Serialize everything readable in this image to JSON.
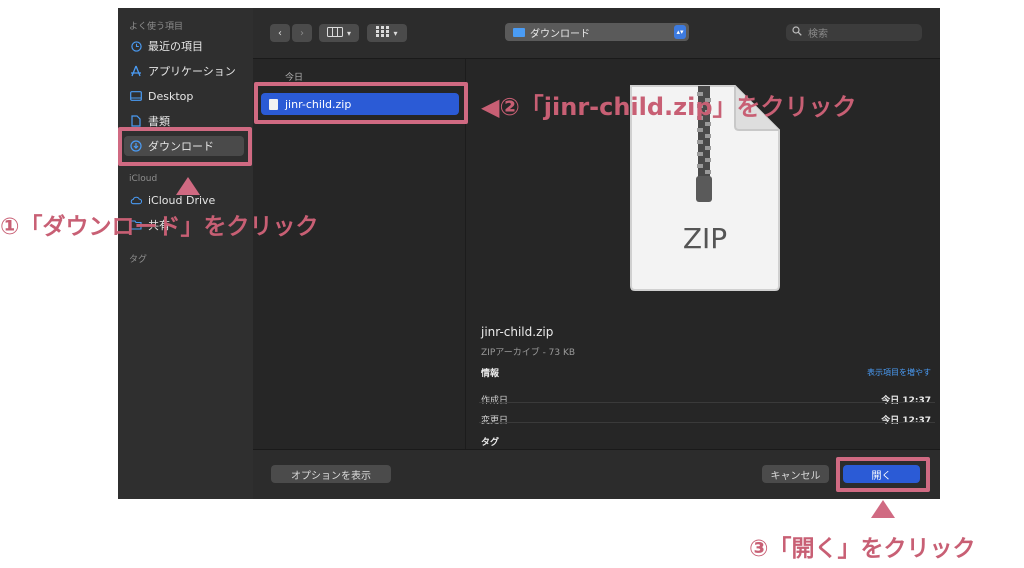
{
  "sidebar": {
    "favorites_header": "よく使う項目",
    "items": [
      {
        "label": "最近の項目",
        "icon": "clock-icon"
      },
      {
        "label": "アプリケーション",
        "icon": "applications-icon"
      },
      {
        "label": "Desktop",
        "icon": "desktop-icon"
      },
      {
        "label": "書類",
        "icon": "document-icon"
      },
      {
        "label": "ダウンロード",
        "icon": "download-icon",
        "selected": true
      }
    ],
    "icloud_header": "iCloud",
    "icloud_items": [
      {
        "label": "iCloud Drive",
        "icon": "cloud-icon"
      },
      {
        "label": "共有",
        "icon": "shared-folder-icon"
      }
    ],
    "tags_header": "タグ"
  },
  "toolbar": {
    "location": "ダウンロード",
    "search_placeholder": "検索"
  },
  "file_list": {
    "group_label": "今日",
    "files": [
      {
        "name": "jinr-child.zip",
        "selected": true
      }
    ]
  },
  "preview": {
    "icon_label": "ZIP",
    "filename": "jinr-child.zip",
    "kind_size": "ZIPアーカイブ - 73 KB",
    "info_header": "情報",
    "show_more": "表示項目を増やす",
    "created_label": "作成日",
    "created_value": "今日 12:37",
    "modified_label": "変更日",
    "modified_value": "今日 12:37",
    "tags_header": "タグ"
  },
  "bottom": {
    "options_label": "オプションを表示",
    "cancel_label": "キャンセル",
    "open_label": "開く"
  },
  "annotations": {
    "step1": "①「ダウンロード」をクリック",
    "step2": "◀②「jinr-child.zip」をクリック",
    "step3": "③「開く」をクリック"
  },
  "colors": {
    "accent": "#d06a82",
    "selection_blue": "#2b5bd6"
  }
}
